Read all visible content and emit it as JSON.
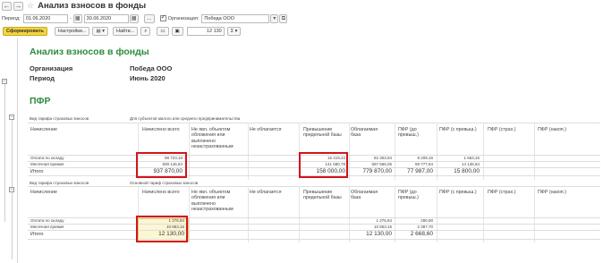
{
  "titlebar": {
    "back_icon": "←",
    "forward_icon": "→",
    "title": "Анализ взносов в фонды"
  },
  "periodbar": {
    "period_label": "Период:",
    "date_from": "01.06.2020",
    "date_to": "30.06.2020",
    "org_label": "Организация:",
    "org_value": "Победа ООО"
  },
  "toolbar": {
    "generate": "Сформировать",
    "settings": "Настройки...",
    "find": "Найти...",
    "sum_value": "12 130",
    "sigma": "Σ"
  },
  "report": {
    "title": "Анализ взносов в фонды",
    "org_label": "Организация",
    "org_value": "Победа ООО",
    "period_label": "Период",
    "period_value": "Июнь 2020",
    "section": "ПФР",
    "headers": {
      "accrual": "Начисление",
      "accrued_total": "Начислено всего",
      "not_object": "Не явл. объектом обложения или выплачено незастрахованным",
      "not_taxed": "Не облагается",
      "excess": "Превышение предельной базы",
      "taxable": "Облагаемая база",
      "pfr_to": "ПФР (до превыш.)",
      "pfr_from": "ПФР (с превыш.)",
      "pfr_ins": "ПФР (страх.)",
      "pfr_acc": "ПФР (накоп.)"
    },
    "block1": {
      "tariff_label": "Вид тарифа страховых взносов",
      "tariff_value": "Для субъектов малого или среднего предпринимательства",
      "rows": [
        {
          "name": "Оплата по окладу",
          "total": "98 723,16",
          "excess": "16 419,22",
          "taxable": "82 303,94",
          "pfr_to": "8 209,16",
          "pfr_from": "1 663,16"
        },
        {
          "name": "Месячная премия",
          "total": "839 146,84",
          "excess": "141 580,78",
          "taxable": "697 566,06",
          "pfr_to": "69 777,84",
          "pfr_from": "14 136,84"
        }
      ],
      "total": {
        "name": "Итого",
        "total": "937 870,00",
        "excess": "158 000,00",
        "taxable": "779 870,00",
        "pfr_to": "77 987,00",
        "pfr_from": "15 800,00"
      }
    },
    "block2": {
      "tariff_label": "Вид тарифа страховых взносов",
      "tariff_value": "Основной тариф страховых взносов",
      "rows": [
        {
          "name": "Оплата по окладу",
          "total": "1 276,84",
          "taxable": "1 276,84",
          "pfr_to": "280,90"
        },
        {
          "name": "Месячная премия",
          "total": "10 853,16",
          "taxable": "10 853,16",
          "pfr_to": "2 387,70"
        }
      ],
      "total": {
        "name": "Итого",
        "total": "12 130,00",
        "taxable": "12 130,00",
        "pfr_to": "2 668,60"
      }
    }
  }
}
